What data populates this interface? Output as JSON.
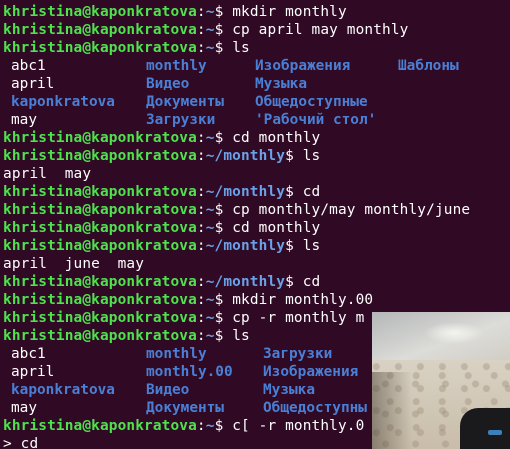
{
  "prompt": {
    "user_host": "khristina@kaponkratova",
    "home": "~",
    "monthly": "~/monthly",
    "dollar": "$"
  },
  "commands": {
    "c1": "mkdir monthly",
    "c2": "cp april may monthly",
    "c3": "ls",
    "c4": "cd monthly",
    "c5": "ls",
    "c6": "cd",
    "c7": "cp monthly/may monthly/june",
    "c8": "cd monthly",
    "c9": "ls",
    "c10": "cd",
    "c11": "mkdir monthly.00",
    "c12": "cp -r monthly m",
    "c13": "ls",
    "c14": "c[ -r monthly.0"
  },
  "ls_output_1": [
    [
      "abc1",
      "monthly",
      "Изображения",
      "Шаблоны"
    ],
    [
      "april",
      "Видео",
      "Музыка",
      ""
    ],
    [
      "kaponkratova",
      "Документы",
      "Общедоступные",
      ""
    ],
    [
      "may",
      "Загрузки",
      "'Рабочий стол'",
      ""
    ]
  ],
  "ls_monthly_1": "april  may",
  "ls_monthly_2": "april  june  may",
  "ls_output_2": [
    [
      "abc1",
      "monthly",
      "Загрузки"
    ],
    [
      "april",
      "monthly.00",
      "Изображения"
    ],
    [
      "kaponkratova",
      "Видео",
      "Музыка"
    ],
    [
      "may",
      "Документы",
      "Общедоступны"
    ]
  ],
  "continuation": "> cd",
  "colors": {
    "background": "#300a24",
    "prompt_user": "#4ee34e",
    "prompt_path": "#6aa1e8",
    "directory": "#4a7fd6",
    "text": "#ffffff"
  }
}
